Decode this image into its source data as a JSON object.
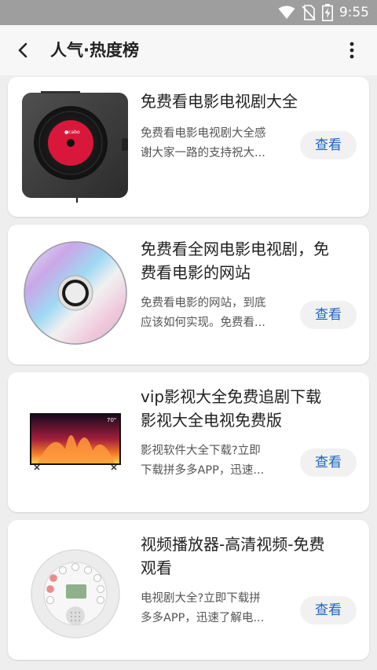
{
  "status_bar": {
    "time": "9:55"
  },
  "app_bar": {
    "title": "人气·热度榜"
  },
  "items": [
    {
      "title_lines": [
        "免费看电影电视剧大全"
      ],
      "desc_lines": [
        "免费看电影电视剧大全感",
        "谢大家一路的支持祝大..."
      ],
      "button": "查看",
      "thumb_icon": "cd-player-icon"
    },
    {
      "title_lines": [
        "免费看全网电影电视剧，免",
        "费看电影的网站"
      ],
      "desc_lines": [
        "免费看电影的网站，到底",
        "应该如何实现。免费看..."
      ],
      "button": "查看",
      "thumb_icon": "disc-icon"
    },
    {
      "title_lines": [
        "vip影视大全免费追剧下载",
        "影视大全电视免费版"
      ],
      "desc_lines": [
        "影视软件大全下载?立即",
        "下载拼多多APP，迅速..."
      ],
      "button": "查看",
      "thumb_icon": "television-icon",
      "tv_badge": "70\""
    },
    {
      "title_lines": [
        "视频播放器-高清视频-免费",
        "观看"
      ],
      "desc_lines": [
        "电视剧大全?立即下载拼",
        "多多APP，迅速了解电..."
      ],
      "button": "查看",
      "thumb_icon": "media-player-icon"
    }
  ]
}
